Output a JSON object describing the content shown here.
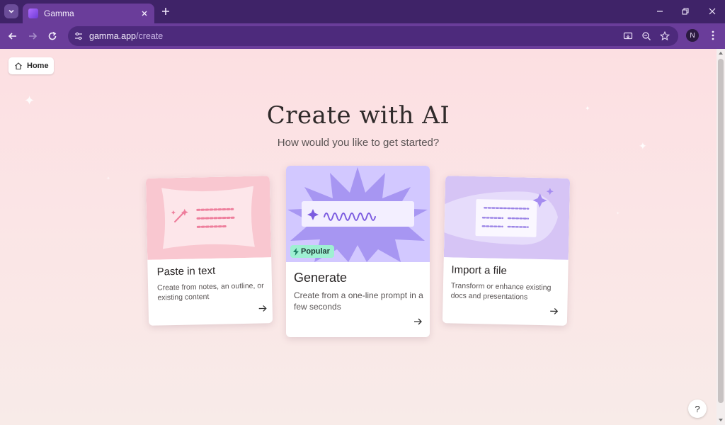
{
  "browser": {
    "tab_title": "Gamma",
    "url_host": "gamma.app",
    "url_path": "/create",
    "profile_initial": "N"
  },
  "page": {
    "home_label": "Home",
    "heading": "Create with AI",
    "subheading": "How would you like to get started?",
    "help_label": "?"
  },
  "cards": [
    {
      "title": "Paste in text",
      "description": "Create from notes, an outline, or existing content"
    },
    {
      "title": "Generate",
      "description": "Create from a one-line prompt in a few seconds",
      "badge": "Popular"
    },
    {
      "title": "Import a file",
      "description": "Transform or enhance existing docs and presentations"
    }
  ],
  "colors": {
    "chrome_dark": "#3f2368",
    "chrome": "#6a3d9a",
    "accent": "#7c5ce0",
    "pink_art": "#f9c7d0",
    "lavender_art": "#d2c8ff",
    "popular_badge": "#9ef0d2"
  }
}
